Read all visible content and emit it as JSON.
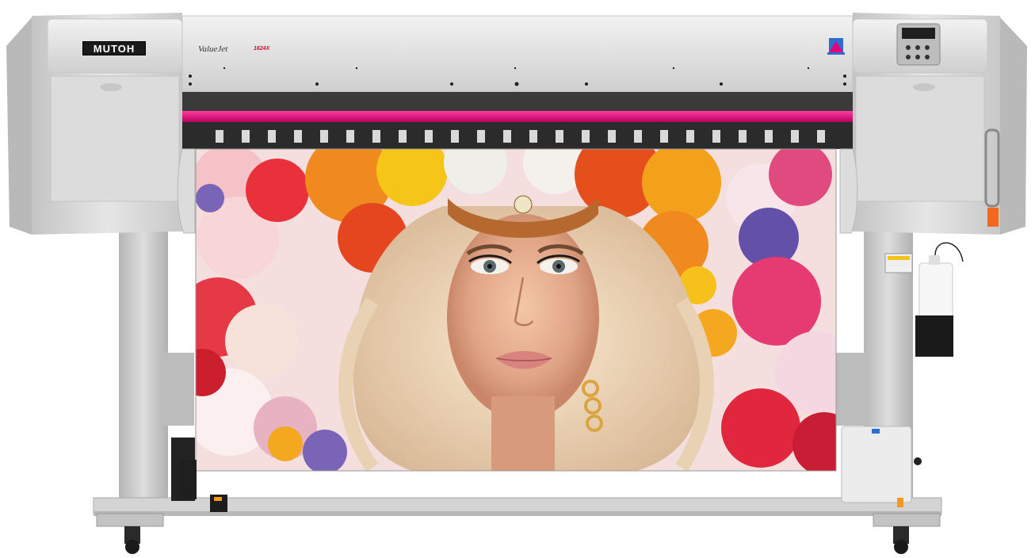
{
  "printer": {
    "brand": "MUTOH",
    "model_name": "ValueJet",
    "model_number": "1624X"
  },
  "colors": {
    "body": "#d9d9d9",
    "body_shadow": "#bdbdbd",
    "body_light": "#eeeeee",
    "accent_magenta": "#e6007e",
    "stand": "#c9c9c9",
    "black": "#1a1a1a"
  }
}
